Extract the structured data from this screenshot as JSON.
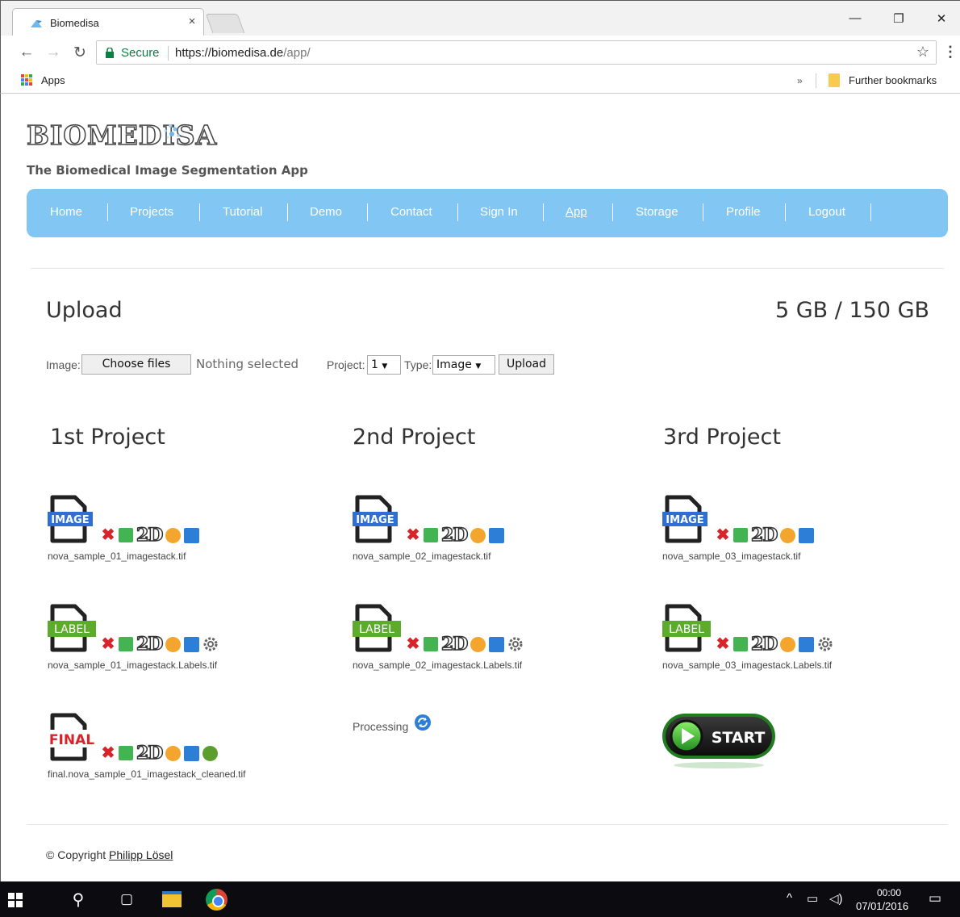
{
  "browser": {
    "tab_title": "Biomedisa",
    "tab_close": "×",
    "secure_label": "Secure",
    "url_main": "https://biomedisa.de",
    "url_rest": "/app/",
    "apps_label": "Apps",
    "bookmark_chevron": "»",
    "bookmark_folder": "Further bookmarks",
    "win_min": "—",
    "win_restore": "❐",
    "win_close": "✕"
  },
  "site": {
    "logo_text": "BIOMEDISA",
    "tagline": "The Biomedical Image Segmentation App",
    "nav": [
      {
        "label": "Home"
      },
      {
        "label": "Projects"
      },
      {
        "label": "Tutorial"
      },
      {
        "label": "Demo"
      },
      {
        "label": "Contact"
      },
      {
        "label": "Sign In"
      },
      {
        "label": "App"
      },
      {
        "label": "Storage"
      },
      {
        "label": "Profile"
      },
      {
        "label": "Logout"
      }
    ],
    "nav_accent": "#82c6f3"
  },
  "upload": {
    "title": "Upload",
    "quota": "5 GB / 150 GB",
    "image_label": "Image:",
    "choose_files": "Choose files",
    "nothing_selected": "Nothing selected",
    "project_label": "Project:",
    "project_value": "1",
    "type_label": "Type:",
    "type_value": "Image",
    "upload_button": "Upload"
  },
  "projects": [
    {
      "title": "1st Project",
      "files": [
        {
          "kind": "IMAGE",
          "name": "nova_sample_01_imagestack.tif"
        },
        {
          "kind": "LABEL",
          "name": "nova_sample_01_imagestack.Labels.tif"
        },
        {
          "kind": "FINAL",
          "name": "final.nova_sample_01_imagestack_cleaned.tif"
        }
      ]
    },
    {
      "title": "2nd Project",
      "files": [
        {
          "kind": "IMAGE",
          "name": "nova_sample_02_imagestack.tif"
        },
        {
          "kind": "LABEL",
          "name": "nova_sample_02_imagestack.Labels.tif"
        }
      ],
      "status": "Processing"
    },
    {
      "title": "3rd Project",
      "files": [
        {
          "kind": "IMAGE",
          "name": "nova_sample_03_imagestack.tif"
        },
        {
          "kind": "LABEL",
          "name": "nova_sample_03_imagestack.Labels.tif"
        }
      ],
      "start_label": "START"
    }
  ],
  "action_labels": {
    "delete": "✖",
    "two_d": "2D"
  },
  "footer": {
    "copyright_prefix": "© Copyright ",
    "author": "Philipp Lösel"
  },
  "taskbar": {
    "time": "00:00",
    "date": "07/01/2016"
  }
}
